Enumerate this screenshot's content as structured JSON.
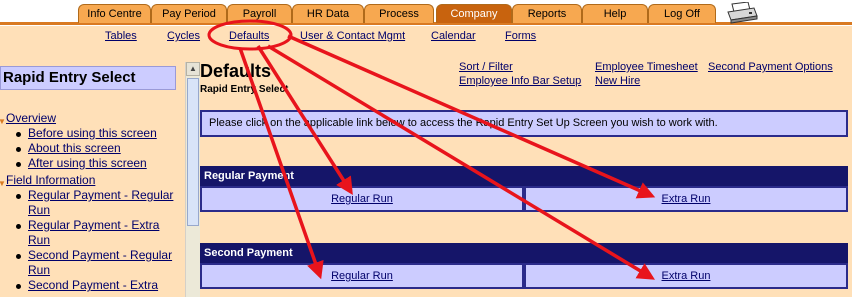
{
  "tabs": [
    {
      "label": "Info Centre"
    },
    {
      "label": "Pay Period"
    },
    {
      "label": "Payroll"
    },
    {
      "label": "HR Data"
    },
    {
      "label": "Process"
    },
    {
      "label": "Company"
    },
    {
      "label": "Reports"
    },
    {
      "label": "Help"
    },
    {
      "label": "Log Off"
    }
  ],
  "active_tab": "Company",
  "submenu": [
    "Tables",
    "Cycles",
    "Defaults",
    "User & Contact Mgmt",
    "Calendar",
    "Forms"
  ],
  "left_panel": {
    "title": "Rapid Entry Select",
    "sections": [
      {
        "label": "Overview",
        "items": [
          "Before using this screen",
          "About this screen",
          "After using this screen"
        ]
      },
      {
        "label": "Field Information",
        "items": [
          "Regular Payment - Regular Run",
          "Regular Payment - Extra Run",
          "Second Payment - Regular Run",
          "Second Payment - Extra"
        ]
      }
    ]
  },
  "page": {
    "title": "Defaults",
    "subtitle": "Rapid Entry Select",
    "links": [
      "Sort / Filter",
      "Employee Info Bar Setup",
      "Employee Timesheet",
      "New Hire",
      "Second Payment Options"
    ],
    "instruction": "Please click on the applicable link below to access the Rapid Entry Set Up Screen you wish to work with.",
    "sections": [
      {
        "header": "Regular Payment",
        "regular": "Regular Run",
        "extra": "Extra Run"
      },
      {
        "header": "Second Payment",
        "regular": "Regular Run",
        "extra": "Extra Run"
      }
    ]
  },
  "colors": {
    "annotation": "#e8141c",
    "tab": "#f7a850",
    "active_tab": "#c8630e",
    "header": "#151569",
    "cell": "#ccccff",
    "background": "#ffe0b8"
  },
  "icons": {
    "printer": "printer-icon"
  }
}
